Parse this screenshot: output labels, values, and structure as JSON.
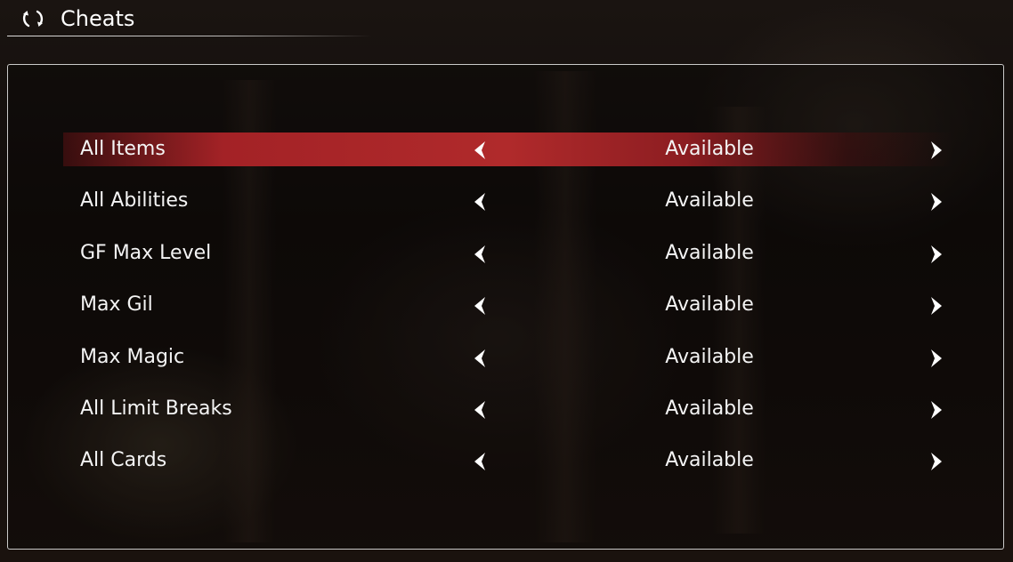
{
  "header": {
    "title": "Cheats",
    "icon": "refresh-icon"
  },
  "cheats": [
    {
      "label": "All Items",
      "value": "Available",
      "selected": true
    },
    {
      "label": "All Abilities",
      "value": "Available",
      "selected": false
    },
    {
      "label": "GF Max Level",
      "value": "Available",
      "selected": false
    },
    {
      "label": "Max Gil",
      "value": "Available",
      "selected": false
    },
    {
      "label": "Max Magic",
      "value": "Available",
      "selected": false
    },
    {
      "label": "All Limit Breaks",
      "value": "Available",
      "selected": false
    },
    {
      "label": "All Cards",
      "value": "Available",
      "selected": false
    }
  ],
  "icons": {
    "prev": "chevron-left-icon",
    "next": "chevron-right-icon"
  },
  "colors": {
    "highlight": "#b02a2b",
    "text": "#f4f4f4",
    "border": "#ebebeb"
  }
}
